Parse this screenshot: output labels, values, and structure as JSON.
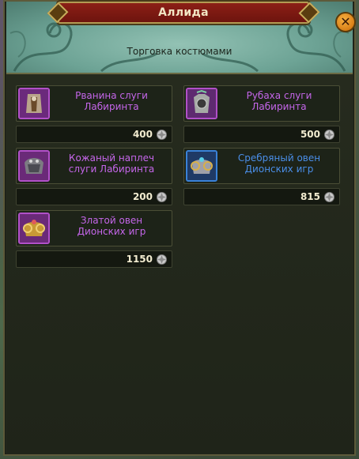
{
  "window": {
    "title": "Аллида",
    "subtitle": "Торговка костюмами",
    "close_icon": "close-icon"
  },
  "currency_icon": "silver-coin-icon",
  "items": [
    {
      "name_line1": "Рванина слуги",
      "name_line2": "Лабиринта",
      "price": "400",
      "rarity": "epic",
      "color": "#c566ea",
      "icon": "rag-cloak-icon"
    },
    {
      "name_line1": "Рубаха слуги",
      "name_line2": "Лабиринта",
      "price": "500",
      "rarity": "epic",
      "color": "#c566ea",
      "icon": "shirt-icon"
    },
    {
      "name_line1": "Кожаный наплеч",
      "name_line2": "слуги Лабиринта",
      "price": "200",
      "rarity": "epic",
      "color": "#c566ea",
      "icon": "shoulder-armor-icon"
    },
    {
      "name_line1": "Сребряный овен",
      "name_line2": "Дионских игр",
      "price": "815",
      "rarity": "rare",
      "color": "#4a8ee8",
      "icon": "silver-ram-helmet-icon"
    },
    {
      "name_line1": "Златой овен",
      "name_line2": "Дионских игр",
      "price": "1150",
      "rarity": "epic",
      "color": "#c566ea",
      "icon": "golden-ram-helmet-icon"
    }
  ]
}
